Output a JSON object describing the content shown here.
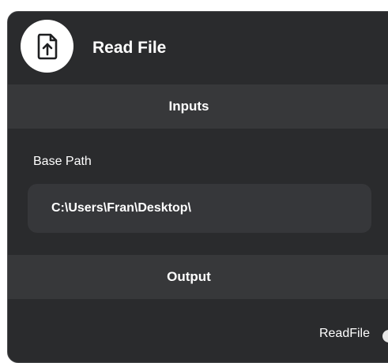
{
  "node": {
    "title": "Read File",
    "icon": "file-upload-icon"
  },
  "inputs": {
    "section_label": "Inputs",
    "fields": [
      {
        "label": "Base Path",
        "value": "C:\\Users\\Fran\\Desktop\\"
      }
    ]
  },
  "output": {
    "section_label": "Output",
    "ports": [
      {
        "label": "ReadFile"
      }
    ]
  },
  "colors": {
    "node_bg": "#2a2b2d",
    "section_bar_bg": "#37383a",
    "field_bg": "#36373a",
    "text": "#ffffff"
  }
}
